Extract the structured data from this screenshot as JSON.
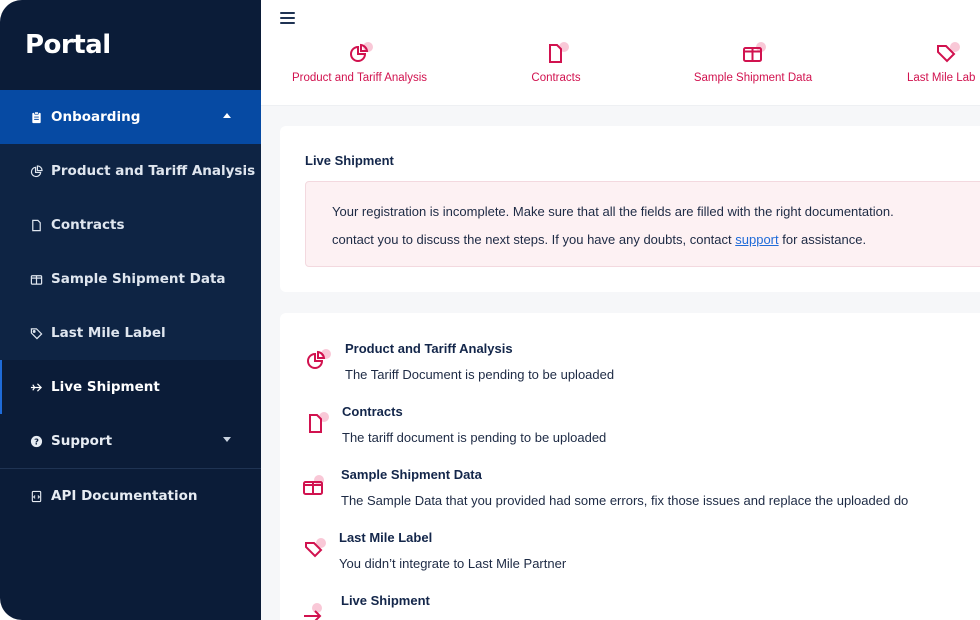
{
  "brand": "Portal",
  "sidebar": {
    "items": [
      {
        "label": "Onboarding",
        "icon": "clipboard-icon"
      },
      {
        "label": "Product and Tariff Analysis",
        "icon": "pie-chart-icon"
      },
      {
        "label": "Contracts",
        "icon": "document-icon"
      },
      {
        "label": "Sample Shipment Data",
        "icon": "box-icon"
      },
      {
        "label": "Last Mile Label",
        "icon": "tag-icon"
      },
      {
        "label": "Live Shipment",
        "icon": "airplane-icon"
      },
      {
        "label": "Support",
        "icon": "help-icon"
      },
      {
        "label": "API Documentation",
        "icon": "code-file-icon"
      }
    ]
  },
  "steps": [
    {
      "label": "Product and Tariff Analysis",
      "icon": "pie-chart-icon"
    },
    {
      "label": "Contracts",
      "icon": "document-icon"
    },
    {
      "label": "Sample Shipment Data",
      "icon": "box-icon"
    },
    {
      "label": "Last Mile Lab",
      "icon": "tag-icon"
    }
  ],
  "live_card": {
    "title": "Live Shipment",
    "alert_line1": "Your registration is incomplete. Make sure that all the fields are filled with the right documentation.",
    "alert_line2_before": "contact you to discuss the next steps. If you have any doubts, contact ",
    "alert_link": "support",
    "alert_line2_after": " for assistance."
  },
  "status_list": [
    {
      "title": "Product and Tariff Analysis",
      "desc": "The Tariff Document is pending to be uploaded",
      "icon": "pie-chart-icon"
    },
    {
      "title": "Contracts",
      "desc": "The tariff document is pending to be uploaded",
      "icon": "document-icon"
    },
    {
      "title": "Sample Shipment Data",
      "desc": "The Sample Data that you provided had some errors, fix those issues and replace the uploaded do",
      "icon": "box-icon"
    },
    {
      "title": "Last Mile Label",
      "desc": "You didn’t integrate to Last Mile Partner",
      "icon": "tag-icon"
    },
    {
      "title": "Live Shipment",
      "desc": "",
      "icon": "airplane-icon"
    }
  ],
  "colors": {
    "sidebar_bg": "#0b1c38",
    "active_bg": "#064aa3",
    "accent_pink": "#d1124f",
    "link": "#1f6bd8"
  }
}
